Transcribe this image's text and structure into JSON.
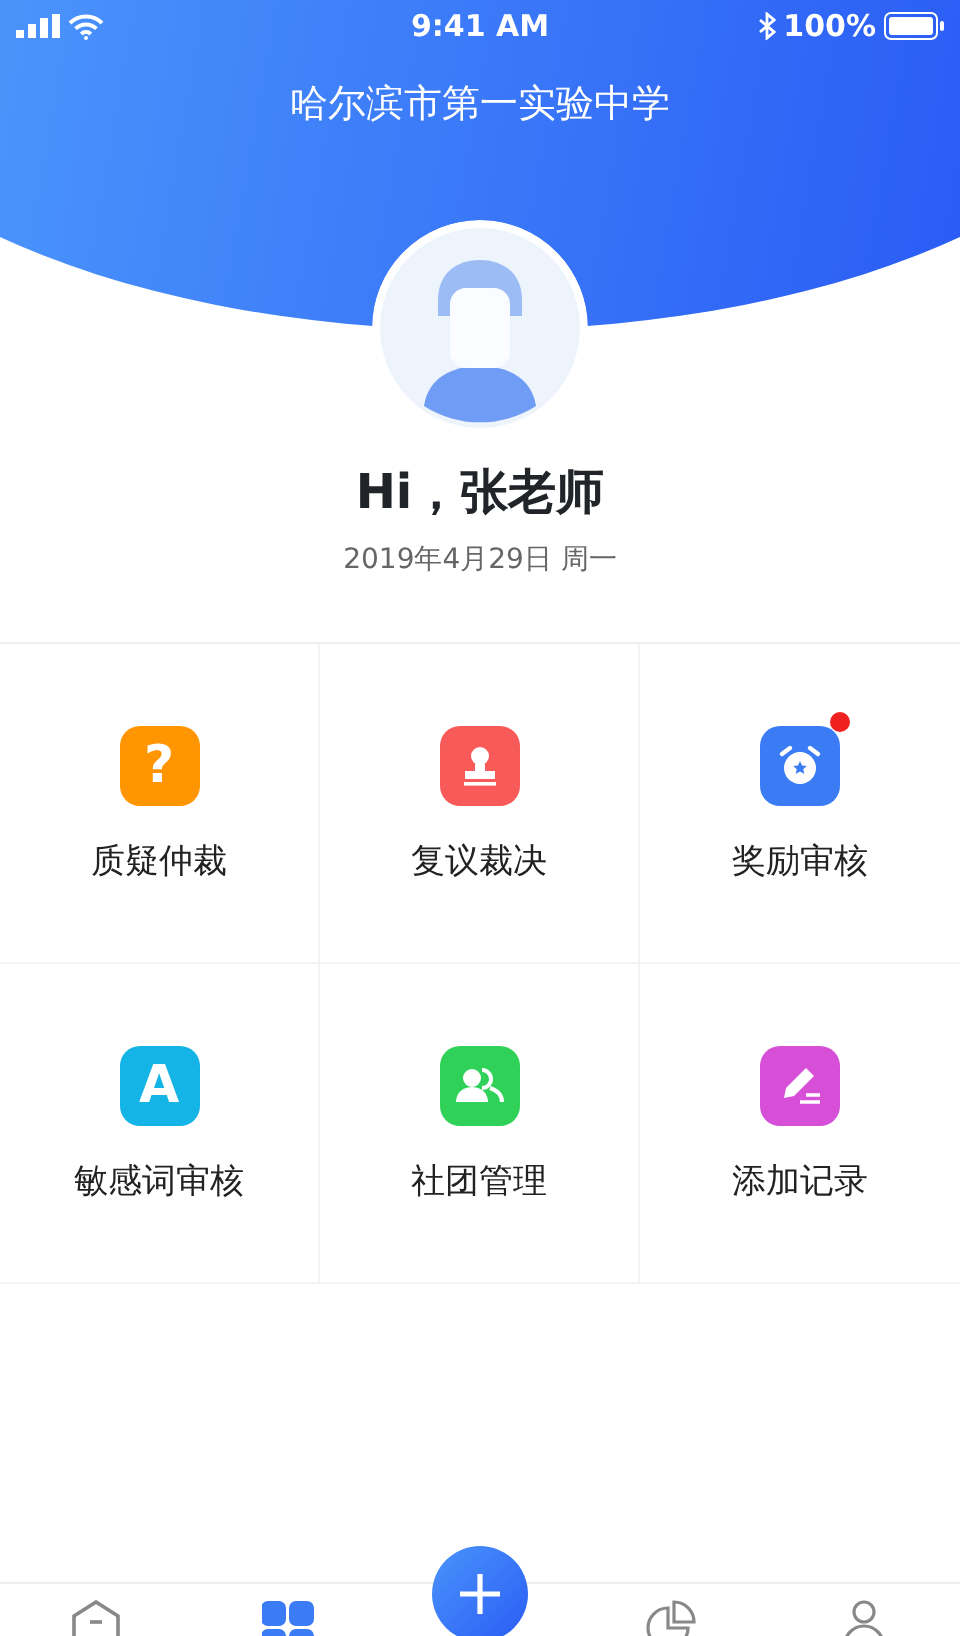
{
  "status_bar": {
    "time": "9:41 AM",
    "battery": "100%"
  },
  "header": {
    "title": "哈尔滨市第一实验中学"
  },
  "greeting": "Hi，张老师",
  "date": "2019年4月29日 周一",
  "menu": [
    {
      "label": "质疑仲裁",
      "kind": "glyph",
      "glyph": "?",
      "color": "#ff9500",
      "badge": false
    },
    {
      "label": "复议裁决",
      "kind": "stamp",
      "color": "#f85a5a",
      "badge": false
    },
    {
      "label": "奖励审核",
      "kind": "alarm",
      "color": "#3b7cf5",
      "badge": true
    },
    {
      "label": "敏感词审核",
      "kind": "glyph",
      "glyph": "A",
      "color": "#14b4e6",
      "badge": false
    },
    {
      "label": "社团管理",
      "kind": "people",
      "color": "#2fd158",
      "badge": false
    },
    {
      "label": "添加记录",
      "kind": "pen",
      "color": "#d64fd6",
      "badge": false
    }
  ],
  "tabs": [
    {
      "kind": "home",
      "selected": false
    },
    {
      "kind": "grid",
      "selected": true
    },
    {
      "kind": "add",
      "selected": false
    },
    {
      "kind": "chart",
      "selected": false
    },
    {
      "kind": "person",
      "selected": false
    }
  ]
}
